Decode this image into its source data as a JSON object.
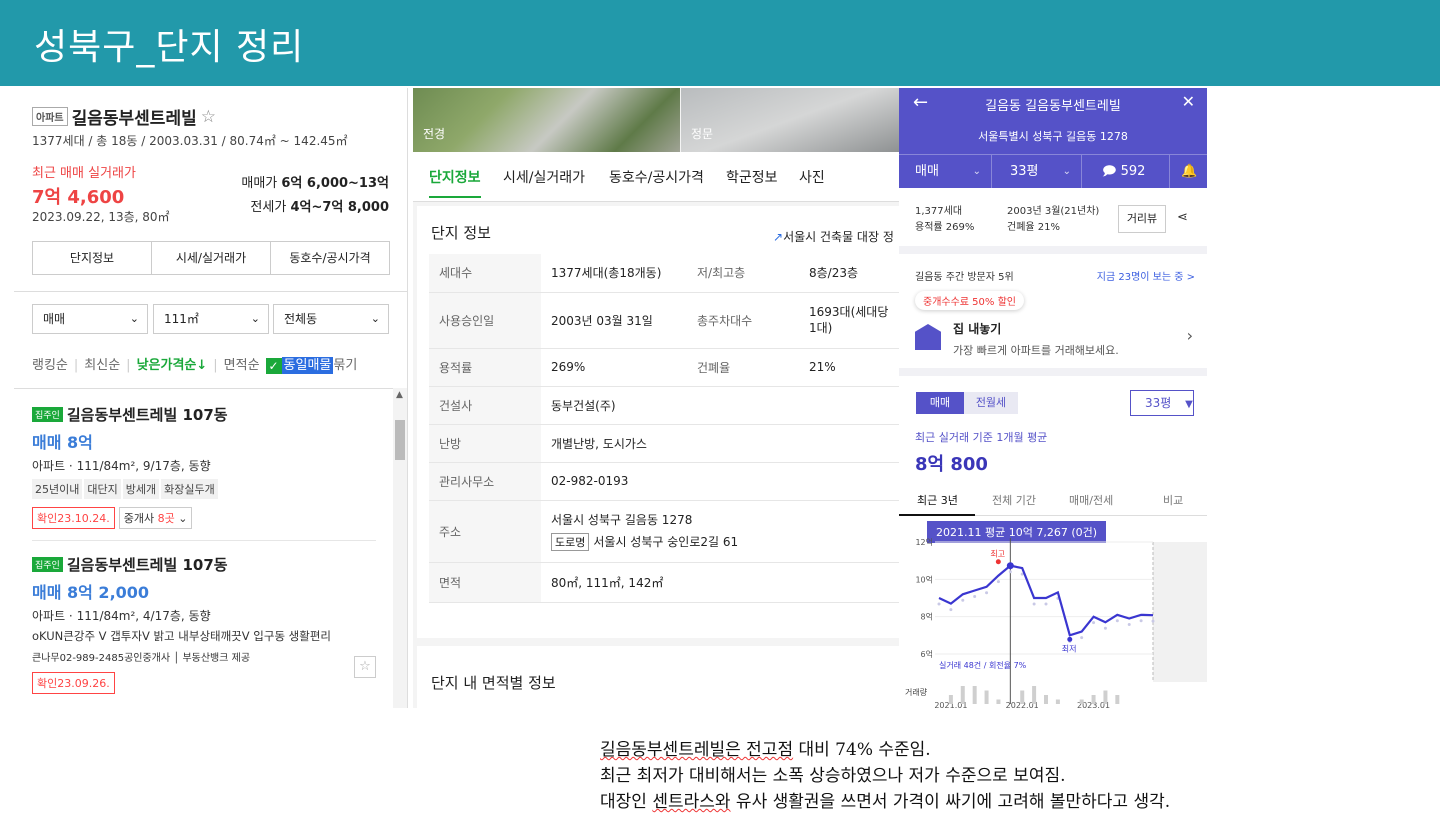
{
  "banner": {
    "title": "성북구_단지 정리"
  },
  "left": {
    "type_badge": "아파트",
    "name": "길음동부센트레빌",
    "star": "☆",
    "info": "1377세대 / 총 18동 / 2003.03.31 / 80.74㎡ ~ 142.45㎡",
    "recent_label": "최근 매매 실거래가",
    "recent_price": "7억 4,600",
    "recent_date": "2023.09.22, 13층, 80㎡",
    "sale_label": "매매가",
    "sale_value": "6억 6,000~13억",
    "jeonse_label": "전세가",
    "jeonse_value": "4억~7억 8,000",
    "tabs": [
      "단지정보",
      "시세/실거래가",
      "동호수/공시가격"
    ],
    "selects": [
      "매매",
      "111㎡",
      "전체동"
    ],
    "sort": {
      "ranking": "랭킹순",
      "latest": "최신순",
      "low_price": "낮은가격순↓",
      "area": "면적순",
      "same": "동일매물",
      "group": "묶기"
    },
    "items": [
      {
        "tag": "집주인",
        "name": "길음동부센트레빌 107동",
        "price": "매매 8억",
        "desc": "아파트 · 111/84m², 9/17층, 동향",
        "chips": [
          "25년이내",
          "대단지",
          "방세개",
          "화장실두개"
        ],
        "confirm": "확인23.10.24.",
        "agent_label": "중개사",
        "agent_count": "8곳"
      },
      {
        "tag": "집주인",
        "name": "길음동부센트레빌 107동",
        "price": "매매 8억 2,000",
        "desc": "아파트 · 111/84m², 4/17층, 동향",
        "line1": "oKUN큰강주 V 갭투자V 밝고 내부상태깨끗V 입구동 생활편리",
        "line2": "큰나무02-989-2485공인중개사 │ 부동산뱅크 제공",
        "confirm": "확인23.09.26."
      }
    ]
  },
  "middle": {
    "photos": [
      "전경",
      "정문"
    ],
    "tabs": [
      "단지정보",
      "시세/실거래가",
      "동호수/공시가격",
      "학군정보",
      "사진"
    ],
    "card_title": "단지 정보",
    "card_link": "서울시 건축물 대장 정",
    "rows": [
      {
        "k": "세대수",
        "v": "1377세대(총18개동)",
        "k2": "저/최고층",
        "v2": "8층/23층"
      },
      {
        "k": "사용승인일",
        "v": "2003년 03월 31일",
        "k2": "총주차대수",
        "v2": "1693대(세대당 1대)"
      },
      {
        "k": "용적률",
        "v": "269%",
        "k2": "건폐율",
        "v2": "21%"
      },
      {
        "k": "건설사",
        "v": "동부건설(주)"
      },
      {
        "k": "난방",
        "v": "개별난방, 도시가스"
      },
      {
        "k": "관리사무소",
        "v": "02-982-0193"
      },
      {
        "k": "주소",
        "v": "서울시 성북구 길음동 1278",
        "road": "도로명",
        "v_road": "서울시 성북구 숭인로2길 61"
      },
      {
        "k": "면적",
        "v": "80㎡, 111㎡, 142㎡"
      }
    ],
    "card2_title": "단지 내 면적별 정보"
  },
  "right": {
    "title": "길음동 길음동부센트레빌",
    "address": "서울특별시 성북구 길음동 1278",
    "sel_trade": "매매",
    "sel_size": "33평",
    "comments": "592",
    "stats_a1": "1,377세대",
    "stats_a2": "용적률 269%",
    "stats_b1": "2003년 3월(21년차)",
    "stats_b2": "건폐율 21%",
    "street_btn": "거리뷰",
    "visit": "길음동 주간 방문자 5위",
    "visit_now": "지금 23명이 보는 중 >",
    "promo": "중개수수료 50% 할인",
    "house_title": "집 내놓기",
    "house_sub": "가장 빠르게 아파트를 거래해보세요.",
    "trade_tabs": [
      "매매",
      "전월세"
    ],
    "pyeong": "33평",
    "avg_label": "최근 실거래 기준 1개월 평균",
    "avg_value": "8억 800",
    "period_tabs": [
      "최근 3년",
      "전체 기간",
      "매매/전세",
      "비교"
    ],
    "tooltip": "2021.11 평균 10억 7,267 (0건)",
    "chart": {
      "y_ticks": [
        "12억",
        "10억",
        "8억",
        "6억"
      ],
      "x_ticks": [
        "2021.01",
        "2022.01",
        "2023.01"
      ],
      "high_label": "최고",
      "low_label": "최저",
      "volume_label": "거래량",
      "summary": "실거래 48건 / 회전율 7%"
    }
  },
  "chart_data": {
    "type": "line",
    "x": [
      "2020.11",
      "2021.01",
      "2021.03",
      "2021.05",
      "2021.07",
      "2021.09",
      "2021.11",
      "2022.01",
      "2022.03",
      "2022.05",
      "2022.07",
      "2022.09",
      "2022.11",
      "2023.01",
      "2023.03",
      "2023.05",
      "2023.07",
      "2023.09",
      "2023.11"
    ],
    "series": [
      {
        "values": [
          9.0,
          8.7,
          9.2,
          9.4,
          9.6,
          10.2,
          10.73,
          10.6,
          9.0,
          9.0,
          9.3,
          7.0,
          7.2,
          8.0,
          7.7,
          8.1,
          7.9,
          8.1,
          8.08
        ]
      }
    ],
    "ylim": [
      6,
      12
    ],
    "yticks": [
      "12억",
      "10억",
      "8억",
      "6억"
    ],
    "xticks": [
      "2021.01",
      "2022.01",
      "2023.01"
    ],
    "volume": [
      0,
      2,
      4,
      4,
      3,
      1,
      0,
      3,
      4,
      2,
      1,
      0,
      1,
      2,
      3,
      2,
      0,
      0,
      0
    ]
  },
  "notes": [
    {
      "hl": "길음동부센트레빌은 전고점",
      "rest": " 대비 74% 수준임."
    },
    {
      "hl": "",
      "rest": "최근 최저가 대비해서는 소폭 상승하였으나 저가 수준으로 보여짐."
    },
    {
      "pre": "대장인 ",
      "hl": "센트라스와",
      "rest": " 유사 생활권을 쓰면서 가격이 싸기에 고려해 볼만하다고 생각."
    }
  ]
}
